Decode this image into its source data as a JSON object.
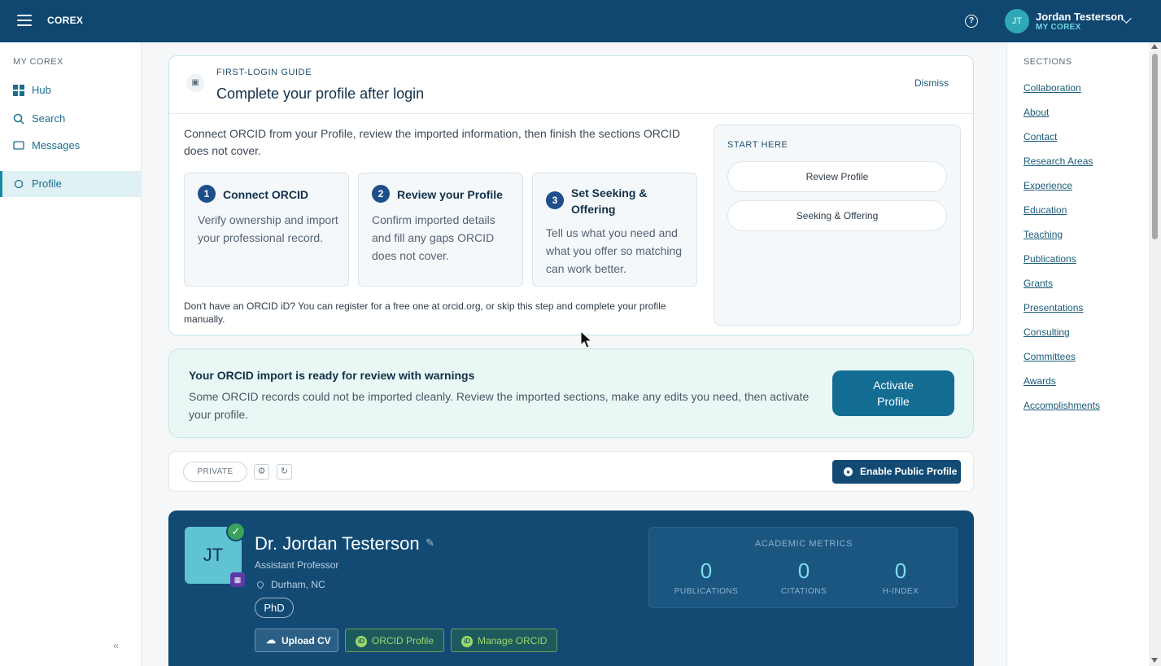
{
  "topbar": {
    "brand": "COREX",
    "user_name": "Jordan Testerson",
    "user_sub": "MY COREX",
    "avatar": "JT",
    "help": "?"
  },
  "sidebar": {
    "heading": "MY COREX",
    "items": [
      {
        "label": "Hub",
        "icon": "grid-icon"
      },
      {
        "label": "Search",
        "icon": "search-icon"
      },
      {
        "label": "Messages",
        "icon": "message-icon"
      },
      {
        "label": "Profile",
        "icon": "circle-icon",
        "active": true
      }
    ],
    "collapse": "«"
  },
  "guide": {
    "overline": "FIRST-LOGIN GUIDE",
    "title": "Complete your profile after login",
    "dismiss": "Dismiss",
    "intro": "Connect ORCID from your Profile, review the imported information, then finish the sections ORCID does not cover.",
    "steps": [
      {
        "num": "1",
        "title": "Connect ORCID",
        "desc": "Verify ownership and import your professional record."
      },
      {
        "num": "2",
        "title": "Review your Profile",
        "desc": "Confirm imported details and fill any gaps ORCID does not cover."
      },
      {
        "num": "3",
        "title": "Set Seeking & Offering",
        "desc": "Tell us what you need and what you offer so matching can work better."
      }
    ],
    "note": "Don't have an ORCID iD? You can register for a free one at orcid.org, or skip this step and complete your profile manually.",
    "start_heading": "START HERE",
    "start_buttons": [
      "Review Profile",
      "Seeking & Offering"
    ]
  },
  "warning": {
    "title": "Your ORCID import is ready for review with warnings",
    "desc": "Some ORCID records could not be imported cleanly. Review the imported sections, make any edits you need, then activate your profile.",
    "button": "Activate Profile"
  },
  "profile_bar": {
    "visibility": "PRIVATE",
    "enable_button": "Enable Public Profile"
  },
  "hero": {
    "initials": "JT",
    "name": "Dr. Jordan Testerson",
    "role": "Assistant Professor",
    "location": "Durham, NC",
    "degree": "PhD",
    "buttons": {
      "upload": "Upload CV",
      "orcid": "ORCID Profile",
      "manage": "Manage ORCID"
    },
    "orcid_icon_text": "iD",
    "metrics_heading": "ACADEMIC METRICS",
    "metrics": [
      {
        "value": "0",
        "label": "PUBLICATIONS"
      },
      {
        "value": "0",
        "label": "CITATIONS"
      },
      {
        "value": "0",
        "label": "H-INDEX"
      }
    ]
  },
  "sections": {
    "heading": "SECTIONS",
    "links": [
      "Collaboration",
      "About",
      "Contact",
      "Research Areas",
      "Experience",
      "Education",
      "Teaching",
      "Publications",
      "Grants",
      "Presentations",
      "Consulting",
      "Committees",
      "Awards",
      "Accomplishments"
    ]
  }
}
